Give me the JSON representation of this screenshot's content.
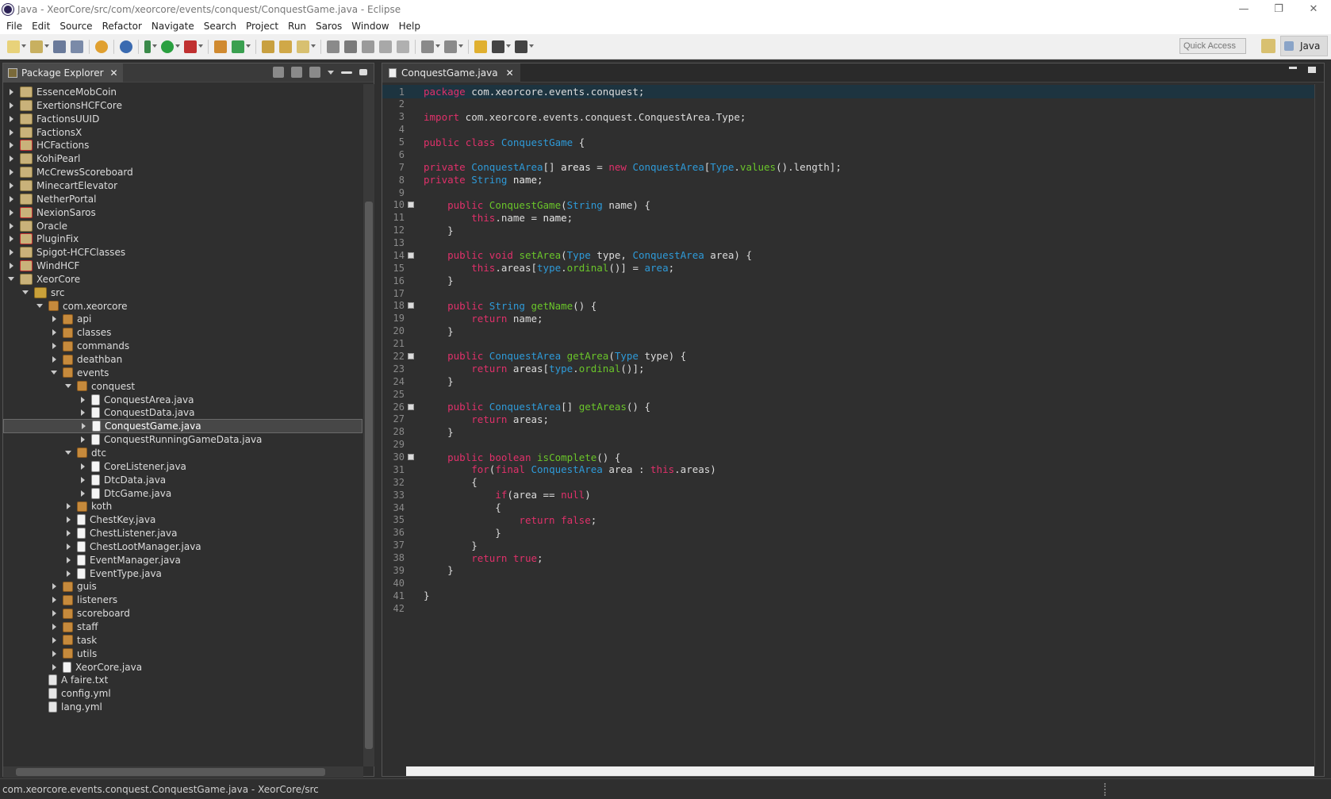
{
  "window": {
    "title": "Java - XeorCore/src/com/xeorcore/events/conquest/ConquestGame.java - Eclipse",
    "controls": [
      "—",
      "❐",
      "✕"
    ]
  },
  "menu": [
    "File",
    "Edit",
    "Source",
    "Refactor",
    "Navigate",
    "Search",
    "Project",
    "Run",
    "Saros",
    "Window",
    "Help"
  ],
  "toolbar": {
    "quick_access_placeholder": "Quick Access",
    "perspective": "Java"
  },
  "package_explorer": {
    "title": "Package Explorer",
    "items": [
      {
        "label": "EssenceMobCoin",
        "depth": 0,
        "state": "closed",
        "icon": "project"
      },
      {
        "label": "ExertionsHCFCore",
        "depth": 0,
        "state": "closed",
        "icon": "project"
      },
      {
        "label": "FactionsUUID",
        "depth": 0,
        "state": "closed",
        "icon": "project"
      },
      {
        "label": "FactionsX",
        "depth": 0,
        "state": "closed",
        "icon": "project"
      },
      {
        "label": "HCFactions",
        "depth": 0,
        "state": "closed",
        "icon": "project-err"
      },
      {
        "label": "KohiPearl",
        "depth": 0,
        "state": "closed",
        "icon": "project"
      },
      {
        "label": "McCrewsScoreboard",
        "depth": 0,
        "state": "closed",
        "icon": "project"
      },
      {
        "label": "MinecartElevator",
        "depth": 0,
        "state": "closed",
        "icon": "project"
      },
      {
        "label": "NetherPortal",
        "depth": 0,
        "state": "closed",
        "icon": "project"
      },
      {
        "label": "NexionSaros",
        "depth": 0,
        "state": "closed",
        "icon": "project-err"
      },
      {
        "label": "Oracle",
        "depth": 0,
        "state": "closed",
        "icon": "project"
      },
      {
        "label": "PluginFix",
        "depth": 0,
        "state": "closed",
        "icon": "project-err"
      },
      {
        "label": "Spigot-HCFClasses",
        "depth": 0,
        "state": "closed",
        "icon": "project"
      },
      {
        "label": "WindHCF",
        "depth": 0,
        "state": "closed",
        "icon": "project-err"
      },
      {
        "label": "XeorCore",
        "depth": 0,
        "state": "open",
        "icon": "project"
      },
      {
        "label": "src",
        "depth": 1,
        "state": "open",
        "icon": "src"
      },
      {
        "label": "com.xeorcore",
        "depth": 2,
        "state": "open",
        "icon": "pkg"
      },
      {
        "label": "api",
        "depth": 3,
        "state": "closed",
        "icon": "pkg"
      },
      {
        "label": "classes",
        "depth": 3,
        "state": "closed",
        "icon": "pkg"
      },
      {
        "label": "commands",
        "depth": 3,
        "state": "closed",
        "icon": "pkg"
      },
      {
        "label": "deathban",
        "depth": 3,
        "state": "closed",
        "icon": "pkg"
      },
      {
        "label": "events",
        "depth": 3,
        "state": "open",
        "icon": "pkg"
      },
      {
        "label": "conquest",
        "depth": 4,
        "state": "open",
        "icon": "pkg"
      },
      {
        "label": "ConquestArea.java",
        "depth": 5,
        "state": "closed",
        "icon": "java"
      },
      {
        "label": "ConquestData.java",
        "depth": 5,
        "state": "closed",
        "icon": "java"
      },
      {
        "label": "ConquestGame.java",
        "depth": 5,
        "state": "closed",
        "icon": "java",
        "selected": true
      },
      {
        "label": "ConquestRunningGameData.java",
        "depth": 5,
        "state": "closed",
        "icon": "java"
      },
      {
        "label": "dtc",
        "depth": 4,
        "state": "open",
        "icon": "pkg"
      },
      {
        "label": "CoreListener.java",
        "depth": 5,
        "state": "closed",
        "icon": "java"
      },
      {
        "label": "DtcData.java",
        "depth": 5,
        "state": "closed",
        "icon": "java"
      },
      {
        "label": "DtcGame.java",
        "depth": 5,
        "state": "closed",
        "icon": "java"
      },
      {
        "label": "koth",
        "depth": 4,
        "state": "closed",
        "icon": "pkg"
      },
      {
        "label": "ChestKey.java",
        "depth": 4,
        "state": "closed",
        "icon": "java"
      },
      {
        "label": "ChestListener.java",
        "depth": 4,
        "state": "closed",
        "icon": "java"
      },
      {
        "label": "ChestLootManager.java",
        "depth": 4,
        "state": "closed",
        "icon": "java"
      },
      {
        "label": "EventManager.java",
        "depth": 4,
        "state": "closed",
        "icon": "java"
      },
      {
        "label": "EventType.java",
        "depth": 4,
        "state": "closed",
        "icon": "java"
      },
      {
        "label": "guis",
        "depth": 3,
        "state": "closed",
        "icon": "pkg"
      },
      {
        "label": "listeners",
        "depth": 3,
        "state": "closed",
        "icon": "pkg"
      },
      {
        "label": "scoreboard",
        "depth": 3,
        "state": "closed",
        "icon": "pkg"
      },
      {
        "label": "staff",
        "depth": 3,
        "state": "closed",
        "icon": "pkg"
      },
      {
        "label": "task",
        "depth": 3,
        "state": "closed",
        "icon": "pkg"
      },
      {
        "label": "utils",
        "depth": 3,
        "state": "closed",
        "icon": "pkg"
      },
      {
        "label": "XeorCore.java",
        "depth": 3,
        "state": "closed",
        "icon": "java"
      },
      {
        "label": "A faire.txt",
        "depth": 2,
        "state": "none",
        "icon": "file"
      },
      {
        "label": "config.yml",
        "depth": 2,
        "state": "none",
        "icon": "file"
      },
      {
        "label": "lang.yml",
        "depth": 2,
        "state": "none",
        "icon": "file"
      }
    ]
  },
  "editor": {
    "tab": "ConquestGame.java",
    "lines": [
      {
        "n": "1",
        "fold": false,
        "cur": true,
        "parts": [
          [
            "k",
            "package"
          ],
          [
            "p",
            " com.xeorcore.events.conquest;"
          ]
        ]
      },
      {
        "n": "2",
        "fold": false,
        "parts": []
      },
      {
        "n": "3",
        "fold": false,
        "parts": [
          [
            "k",
            "import"
          ],
          [
            "p",
            " com.xeorcore.events.conquest.ConquestArea.Type;"
          ]
        ]
      },
      {
        "n": "4",
        "fold": false,
        "parts": []
      },
      {
        "n": "5",
        "fold": false,
        "parts": [
          [
            "k",
            "public"
          ],
          [
            "p",
            " "
          ],
          [
            "k",
            "class"
          ],
          [
            "p",
            " "
          ],
          [
            "t",
            "ConquestGame"
          ],
          [
            "p",
            " {"
          ]
        ]
      },
      {
        "n": "6",
        "fold": false,
        "parts": []
      },
      {
        "n": "7",
        "fold": false,
        "parts": [
          [
            "k",
            "private"
          ],
          [
            "p",
            " "
          ],
          [
            "t",
            "ConquestArea"
          ],
          [
            "p",
            "[] "
          ],
          [
            "b",
            "areas"
          ],
          [
            "p",
            " = "
          ],
          [
            "k",
            "new"
          ],
          [
            "p",
            " "
          ],
          [
            "t",
            "ConquestArea"
          ],
          [
            "p",
            "["
          ],
          [
            "t",
            "Type"
          ],
          [
            "p",
            "."
          ],
          [
            "f",
            "values"
          ],
          [
            "p",
            "().length];"
          ]
        ]
      },
      {
        "n": "8",
        "fold": false,
        "parts": [
          [
            "k",
            "private"
          ],
          [
            "p",
            " "
          ],
          [
            "t",
            "String"
          ],
          [
            "p",
            " "
          ],
          [
            "b",
            "name"
          ],
          [
            "p",
            ";"
          ]
        ]
      },
      {
        "n": "9",
        "fold": false,
        "parts": []
      },
      {
        "n": "10",
        "fold": true,
        "parts": [
          [
            "p",
            "    "
          ],
          [
            "k",
            "public"
          ],
          [
            "p",
            " "
          ],
          [
            "f",
            "ConquestGame"
          ],
          [
            "p",
            "("
          ],
          [
            "t",
            "String"
          ],
          [
            "p",
            " name) {"
          ]
        ]
      },
      {
        "n": "11",
        "fold": false,
        "parts": [
          [
            "p",
            "        "
          ],
          [
            "k",
            "this"
          ],
          [
            "p",
            ".name = "
          ],
          [
            "b",
            "name"
          ],
          [
            "p",
            ";"
          ]
        ]
      },
      {
        "n": "12",
        "fold": false,
        "parts": [
          [
            "p",
            "    }"
          ]
        ]
      },
      {
        "n": "13",
        "fold": false,
        "parts": []
      },
      {
        "n": "14",
        "fold": true,
        "parts": [
          [
            "p",
            "    "
          ],
          [
            "k",
            "public"
          ],
          [
            "p",
            " "
          ],
          [
            "k",
            "void"
          ],
          [
            "p",
            " "
          ],
          [
            "f",
            "setArea"
          ],
          [
            "p",
            "("
          ],
          [
            "t",
            "Type"
          ],
          [
            "p",
            " type, "
          ],
          [
            "t",
            "ConquestArea"
          ],
          [
            "p",
            " area) {"
          ]
        ]
      },
      {
        "n": "15",
        "fold": false,
        "parts": [
          [
            "p",
            "        "
          ],
          [
            "k",
            "this"
          ],
          [
            "p",
            ".areas["
          ],
          [
            "t",
            "type"
          ],
          [
            "p",
            "."
          ],
          [
            "f",
            "ordinal"
          ],
          [
            "p",
            "()] = "
          ],
          [
            "t",
            "area"
          ],
          [
            "p",
            ";"
          ]
        ]
      },
      {
        "n": "16",
        "fold": false,
        "parts": [
          [
            "p",
            "    }"
          ]
        ]
      },
      {
        "n": "17",
        "fold": false,
        "parts": []
      },
      {
        "n": "18",
        "fold": true,
        "parts": [
          [
            "p",
            "    "
          ],
          [
            "k",
            "public"
          ],
          [
            "p",
            " "
          ],
          [
            "t",
            "String"
          ],
          [
            "p",
            " "
          ],
          [
            "f",
            "getName"
          ],
          [
            "p",
            "() {"
          ]
        ]
      },
      {
        "n": "19",
        "fold": false,
        "parts": [
          [
            "p",
            "        "
          ],
          [
            "k",
            "return"
          ],
          [
            "p",
            " name;"
          ]
        ]
      },
      {
        "n": "20",
        "fold": false,
        "parts": [
          [
            "p",
            "    }"
          ]
        ]
      },
      {
        "n": "21",
        "fold": false,
        "parts": []
      },
      {
        "n": "22",
        "fold": true,
        "parts": [
          [
            "p",
            "    "
          ],
          [
            "k",
            "public"
          ],
          [
            "p",
            " "
          ],
          [
            "t",
            "ConquestArea"
          ],
          [
            "p",
            " "
          ],
          [
            "f",
            "getArea"
          ],
          [
            "p",
            "("
          ],
          [
            "t",
            "Type"
          ],
          [
            "p",
            " type) {"
          ]
        ]
      },
      {
        "n": "23",
        "fold": false,
        "parts": [
          [
            "p",
            "        "
          ],
          [
            "k",
            "return"
          ],
          [
            "p",
            " areas["
          ],
          [
            "t",
            "type"
          ],
          [
            "p",
            "."
          ],
          [
            "f",
            "ordinal"
          ],
          [
            "p",
            "()];"
          ]
        ]
      },
      {
        "n": "24",
        "fold": false,
        "parts": [
          [
            "p",
            "    }"
          ]
        ]
      },
      {
        "n": "25",
        "fold": false,
        "parts": []
      },
      {
        "n": "26",
        "fold": true,
        "parts": [
          [
            "p",
            "    "
          ],
          [
            "k",
            "public"
          ],
          [
            "p",
            " "
          ],
          [
            "t",
            "ConquestArea"
          ],
          [
            "p",
            "[] "
          ],
          [
            "f",
            "getAreas"
          ],
          [
            "p",
            "() {"
          ]
        ]
      },
      {
        "n": "27",
        "fold": false,
        "parts": [
          [
            "p",
            "        "
          ],
          [
            "k",
            "return"
          ],
          [
            "p",
            " areas;"
          ]
        ]
      },
      {
        "n": "28",
        "fold": false,
        "parts": [
          [
            "p",
            "    }"
          ]
        ]
      },
      {
        "n": "29",
        "fold": false,
        "parts": []
      },
      {
        "n": "30",
        "fold": true,
        "parts": [
          [
            "p",
            "    "
          ],
          [
            "k",
            "public"
          ],
          [
            "p",
            " "
          ],
          [
            "k",
            "boolean"
          ],
          [
            "p",
            " "
          ],
          [
            "f",
            "isComplete"
          ],
          [
            "p",
            "() {"
          ]
        ]
      },
      {
        "n": "31",
        "fold": false,
        "parts": [
          [
            "p",
            "        "
          ],
          [
            "k",
            "for"
          ],
          [
            "p",
            "("
          ],
          [
            "k",
            "final"
          ],
          [
            "p",
            " "
          ],
          [
            "t",
            "ConquestArea"
          ],
          [
            "p",
            " area : "
          ],
          [
            "k",
            "this"
          ],
          [
            "p",
            ".areas)"
          ]
        ]
      },
      {
        "n": "32",
        "fold": false,
        "parts": [
          [
            "p",
            "        {"
          ]
        ]
      },
      {
        "n": "33",
        "fold": false,
        "parts": [
          [
            "p",
            "            "
          ],
          [
            "k",
            "if"
          ],
          [
            "p",
            "(area == "
          ],
          [
            "k",
            "null"
          ],
          [
            "p",
            ")"
          ]
        ]
      },
      {
        "n": "34",
        "fold": false,
        "parts": [
          [
            "p",
            "            {"
          ]
        ]
      },
      {
        "n": "35",
        "fold": false,
        "parts": [
          [
            "p",
            "                "
          ],
          [
            "k",
            "return"
          ],
          [
            "p",
            " "
          ],
          [
            "k",
            "false"
          ],
          [
            "p",
            ";"
          ]
        ]
      },
      {
        "n": "36",
        "fold": false,
        "parts": [
          [
            "p",
            "            }"
          ]
        ]
      },
      {
        "n": "37",
        "fold": false,
        "parts": [
          [
            "p",
            "        }"
          ]
        ]
      },
      {
        "n": "38",
        "fold": false,
        "parts": [
          [
            "p",
            "        "
          ],
          [
            "k",
            "return"
          ],
          [
            "p",
            " "
          ],
          [
            "k",
            "true"
          ],
          [
            "p",
            ";"
          ]
        ]
      },
      {
        "n": "39",
        "fold": false,
        "parts": [
          [
            "p",
            "    }"
          ]
        ]
      },
      {
        "n": "40",
        "fold": false,
        "parts": []
      },
      {
        "n": "41",
        "fold": false,
        "parts": [
          [
            "p",
            "}"
          ]
        ]
      },
      {
        "n": "42",
        "fold": false,
        "parts": []
      }
    ]
  },
  "status": {
    "text": "com.xeorcore.events.conquest.ConquestGame.java - XeorCore/src"
  }
}
